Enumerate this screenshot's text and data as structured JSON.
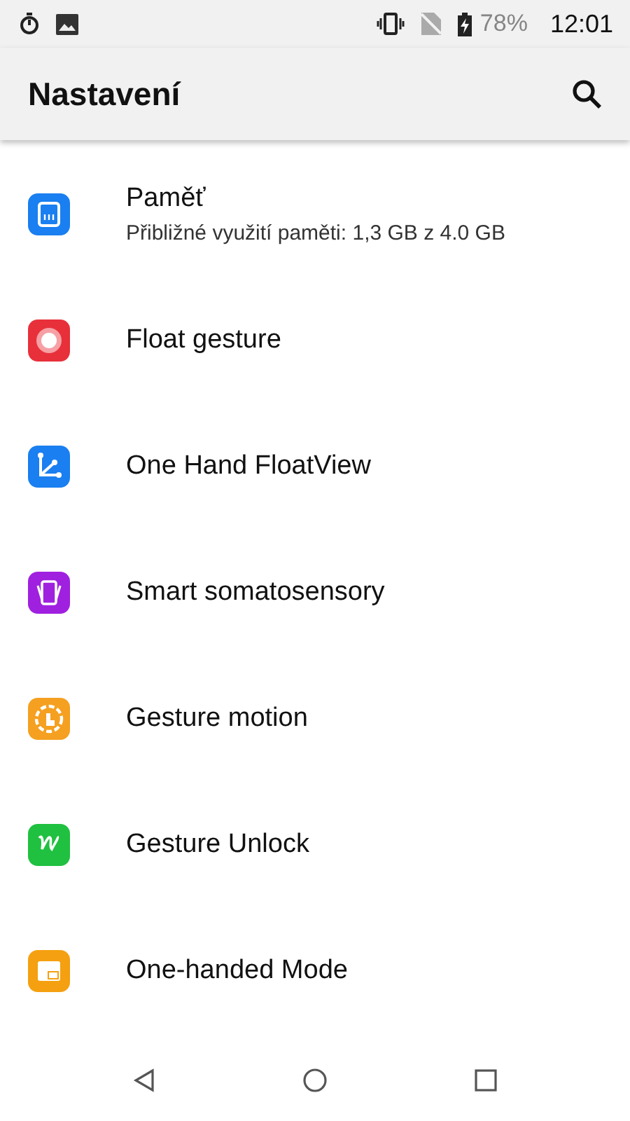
{
  "status_bar": {
    "battery_percent": "78%",
    "time": "12:01"
  },
  "app_bar": {
    "title": "Nastavení"
  },
  "items": [
    {
      "title": "Paměť",
      "subtitle": "Přibližné využití paměti: 1,3 GB z 4.0 GB",
      "color": "#1a7ff0"
    },
    {
      "title": "Float gesture",
      "color": "#e8303a"
    },
    {
      "title": "One Hand FloatView",
      "color": "#1a7ff0"
    },
    {
      "title": "Smart somatosensory",
      "color": "#a020e0"
    },
    {
      "title": "Gesture motion",
      "color": "#f5a020"
    },
    {
      "title": "Gesture Unlock",
      "color": "#20c040"
    },
    {
      "title": "One-handed Mode",
      "color": "#f5a010"
    }
  ]
}
